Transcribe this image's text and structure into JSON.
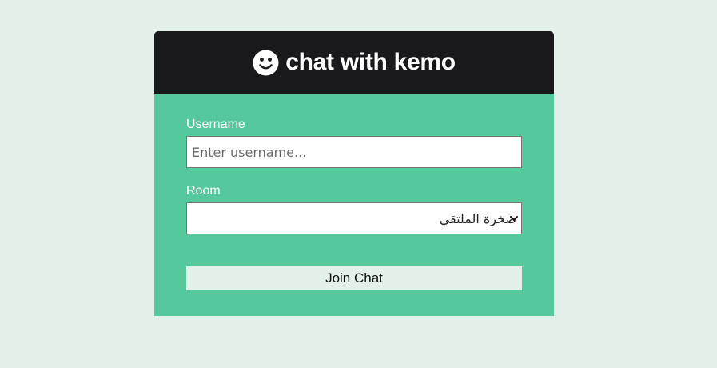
{
  "header": {
    "icon": "smile-icon",
    "title": "chat with kemo"
  },
  "form": {
    "username": {
      "label": "Username",
      "placeholder": "Enter username...",
      "value": ""
    },
    "room": {
      "label": "Room",
      "selected": "صخرة الملتقي"
    },
    "submit_label": "Join Chat"
  },
  "colors": {
    "page_bg": "#e4f1ea",
    "header_bg": "#19191b",
    "main_bg": "#56c99c",
    "button_bg": "#e4f1ea"
  }
}
